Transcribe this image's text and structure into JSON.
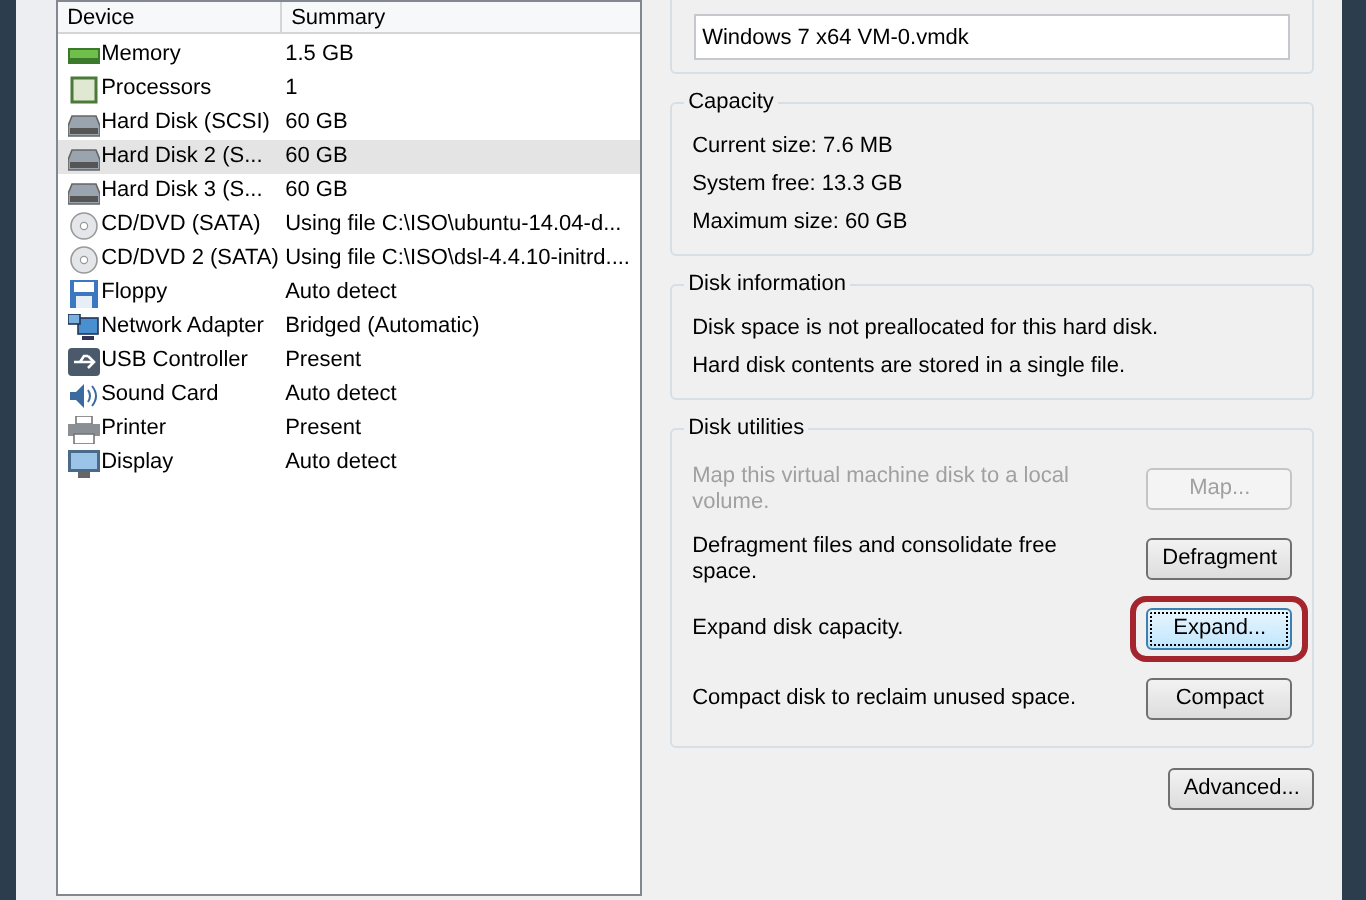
{
  "device_table": {
    "columns": [
      "Device",
      "Summary"
    ],
    "rows": [
      {
        "kind": "memory",
        "device": "Memory",
        "summary": "1.5 GB",
        "selected": false
      },
      {
        "kind": "processor",
        "device": "Processors",
        "summary": "1",
        "selected": false
      },
      {
        "kind": "disk",
        "device": "Hard Disk (SCSI)",
        "summary": "60 GB",
        "selected": false
      },
      {
        "kind": "disk",
        "device": "Hard Disk 2 (S...",
        "summary": "60 GB",
        "selected": true
      },
      {
        "kind": "disk",
        "device": "Hard Disk 3 (S...",
        "summary": "60 GB",
        "selected": false
      },
      {
        "kind": "cd",
        "device": "CD/DVD (SATA)",
        "summary": "Using file C:\\ISO\\ubuntu-14.04-d...",
        "selected": false
      },
      {
        "kind": "cd",
        "device": "CD/DVD 2 (SATA)",
        "summary": "Using file C:\\ISO\\dsl-4.4.10-initrd....",
        "selected": false
      },
      {
        "kind": "floppy",
        "device": "Floppy",
        "summary": "Auto detect",
        "selected": false
      },
      {
        "kind": "network",
        "device": "Network Adapter",
        "summary": "Bridged (Automatic)",
        "selected": false
      },
      {
        "kind": "usb",
        "device": "USB Controller",
        "summary": "Present",
        "selected": false
      },
      {
        "kind": "sound",
        "device": "Sound Card",
        "summary": "Auto detect",
        "selected": false
      },
      {
        "kind": "printer",
        "device": "Printer",
        "summary": "Present",
        "selected": false
      },
      {
        "kind": "display",
        "device": "Display",
        "summary": "Auto detect",
        "selected": false
      }
    ]
  },
  "disk_file": {
    "value": "Windows 7 x64 VM-0.vmdk"
  },
  "capacity": {
    "title": "Capacity",
    "lines": [
      "Current size: 7.6 MB",
      "System free: 13.3 GB",
      "Maximum size: 60 GB"
    ]
  },
  "disk_information": {
    "title": "Disk information",
    "lines": [
      "Disk space is not preallocated for this hard disk.",
      "Hard disk contents are stored in a single file."
    ]
  },
  "disk_utilities": {
    "title": "Disk utilities",
    "items": [
      {
        "description": "Map this virtual machine disk to a local volume.",
        "button": "Map...",
        "disabled": true,
        "highlighted": false
      },
      {
        "description": "Defragment files and consolidate free space.",
        "button": "Defragment",
        "disabled": false,
        "highlighted": false
      },
      {
        "description": "Expand disk capacity.",
        "button": "Expand...",
        "disabled": false,
        "highlighted": true
      },
      {
        "description": "Compact disk to reclaim unused space.",
        "button": "Compact",
        "disabled": false,
        "highlighted": false
      }
    ]
  },
  "advanced_button": "Advanced..."
}
